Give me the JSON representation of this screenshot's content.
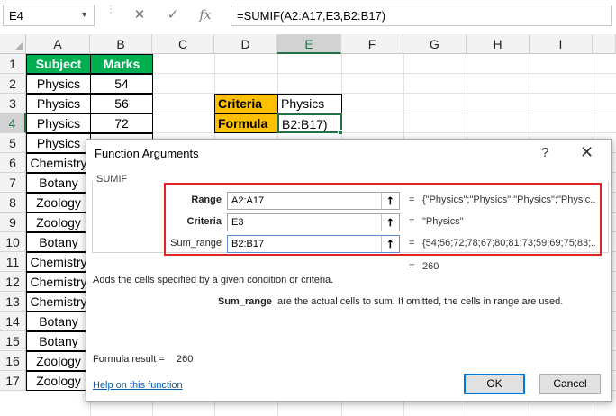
{
  "formula_bar": {
    "name_box": "E4",
    "cancel_icon": "✕",
    "enter_icon": "✓",
    "fx_icon": "fx",
    "formula": "=SUMIF(A2:A17,E3,B2:B17)"
  },
  "columns": [
    "A",
    "B",
    "C",
    "D",
    "E",
    "F",
    "G",
    "H",
    "I"
  ],
  "rows": [
    "1",
    "2",
    "3",
    "4",
    "5",
    "6",
    "7",
    "8",
    "9",
    "10",
    "11",
    "12",
    "13",
    "14",
    "15",
    "16",
    "17"
  ],
  "table": {
    "headers": [
      "Subject",
      "Marks"
    ],
    "data": [
      [
        "Physics",
        "54"
      ],
      [
        "Physics",
        "56"
      ],
      [
        "Physics",
        "72"
      ],
      [
        "Physics",
        ""
      ],
      [
        "Chemistry",
        ""
      ],
      [
        "Botany",
        ""
      ],
      [
        "Zoology",
        ""
      ],
      [
        "Zoology",
        ""
      ],
      [
        "Botany",
        ""
      ],
      [
        "Chemistry",
        ""
      ],
      [
        "Chemistry",
        ""
      ],
      [
        "Chemistry",
        ""
      ],
      [
        "Botany",
        ""
      ],
      [
        "Botany",
        ""
      ],
      [
        "Zoology",
        ""
      ],
      [
        "Zoology",
        ""
      ]
    ]
  },
  "side_table": {
    "criteria_label": "Criteria",
    "criteria_value": "Physics",
    "formula_label": "Formula",
    "formula_value": "B2:B17)"
  },
  "dialog": {
    "title": "Function Arguments",
    "help_icon": "?",
    "close_icon": "✕",
    "function_name": "SUMIF",
    "args": [
      {
        "label": "Range",
        "value": "A2:A17",
        "equals": "=",
        "result": "{\"Physics\";\"Physics\";\"Physics\";\"Physic..."
      },
      {
        "label": "Criteria",
        "value": "E3",
        "equals": "=",
        "result": "\"Physics\""
      },
      {
        "label": "Sum_range",
        "value": "B2:B17",
        "equals": "=",
        "result": "{54;56;72;78;67;80;81;73;59;69;75;83;..."
      }
    ],
    "total_equals": "=",
    "total_value": "260",
    "description": "Adds the cells specified by a given condition or criteria.",
    "arg_desc_name": "Sum_range",
    "arg_desc_text": "are the actual cells to sum. If omitted, the cells in range are used.",
    "formula_result_label": "Formula result =",
    "formula_result_value": "260",
    "help_link": "Help on this function",
    "ok_label": "OK",
    "cancel_label": "Cancel",
    "ref_button_icon": "⭡"
  },
  "colors": {
    "header_green": "#00b050",
    "label_gold": "#ffc000",
    "selection_green": "#217346",
    "highlight_red": "#e02424"
  }
}
